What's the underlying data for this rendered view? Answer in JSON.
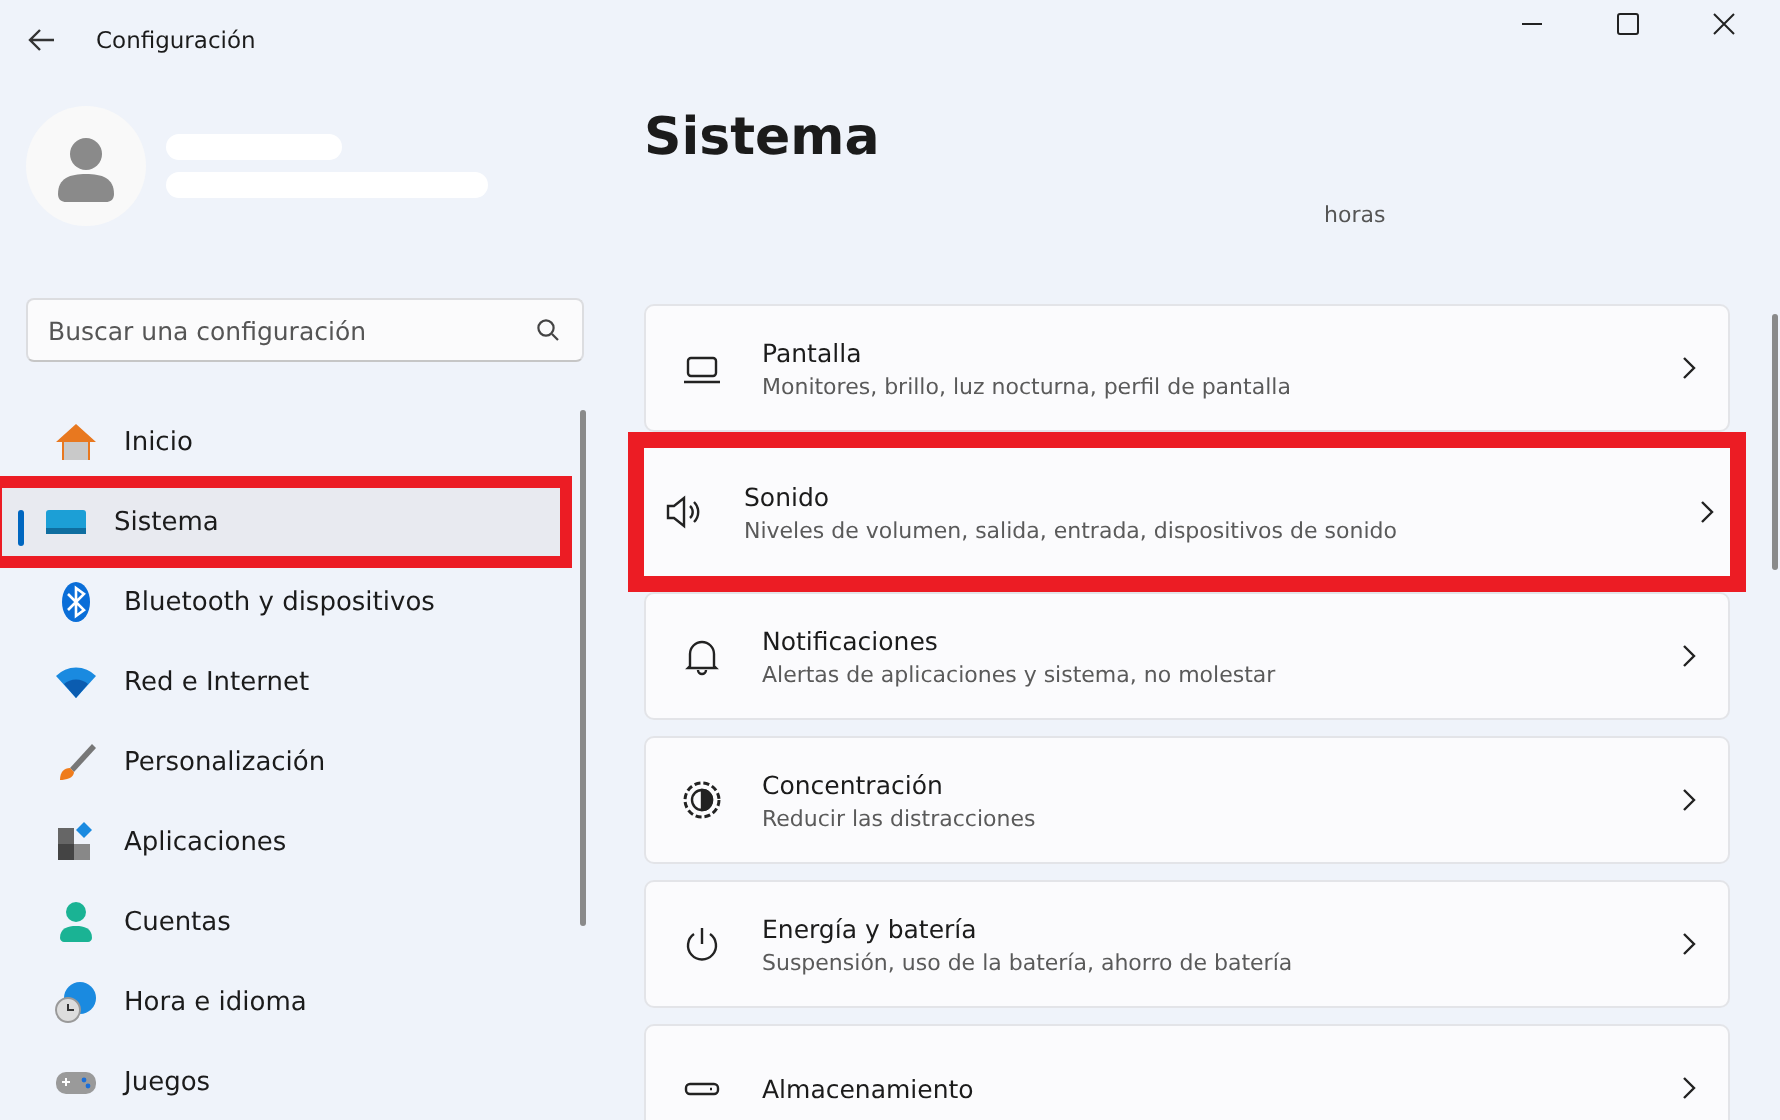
{
  "window": {
    "title": "Configuración"
  },
  "search": {
    "placeholder": "Buscar una configuración"
  },
  "sidebar": {
    "items": [
      {
        "label": "Inicio",
        "selected": false,
        "highlighted": false
      },
      {
        "label": "Sistema",
        "selected": true,
        "highlighted": true
      },
      {
        "label": "Bluetooth y dispositivos",
        "selected": false,
        "highlighted": false
      },
      {
        "label": "Red e Internet",
        "selected": false,
        "highlighted": false
      },
      {
        "label": "Personalización",
        "selected": false,
        "highlighted": false
      },
      {
        "label": "Aplicaciones",
        "selected": false,
        "highlighted": false
      },
      {
        "label": "Cuentas",
        "selected": false,
        "highlighted": false
      },
      {
        "label": "Hora e idioma",
        "selected": false,
        "highlighted": false
      },
      {
        "label": "Juegos",
        "selected": false,
        "highlighted": false
      }
    ]
  },
  "page": {
    "title": "Sistema",
    "note": "horas"
  },
  "settings": [
    {
      "title": "Pantalla",
      "subtitle": "Monitores, brillo, luz nocturna, perfil de pantalla",
      "highlighted": false
    },
    {
      "title": "Sonido",
      "subtitle": "Niveles de volumen, salida, entrada, dispositivos de sonido",
      "highlighted": true
    },
    {
      "title": "Notificaciones",
      "subtitle": "Alertas de aplicaciones y sistema, no molestar",
      "highlighted": false
    },
    {
      "title": "Concentración",
      "subtitle": "Reducir las distracciones",
      "highlighted": false
    },
    {
      "title": "Energía y batería",
      "subtitle": "Suspensión, uso de la batería, ahorro de batería",
      "highlighted": false
    },
    {
      "title": "Almacenamiento",
      "highlighted": false
    }
  ]
}
